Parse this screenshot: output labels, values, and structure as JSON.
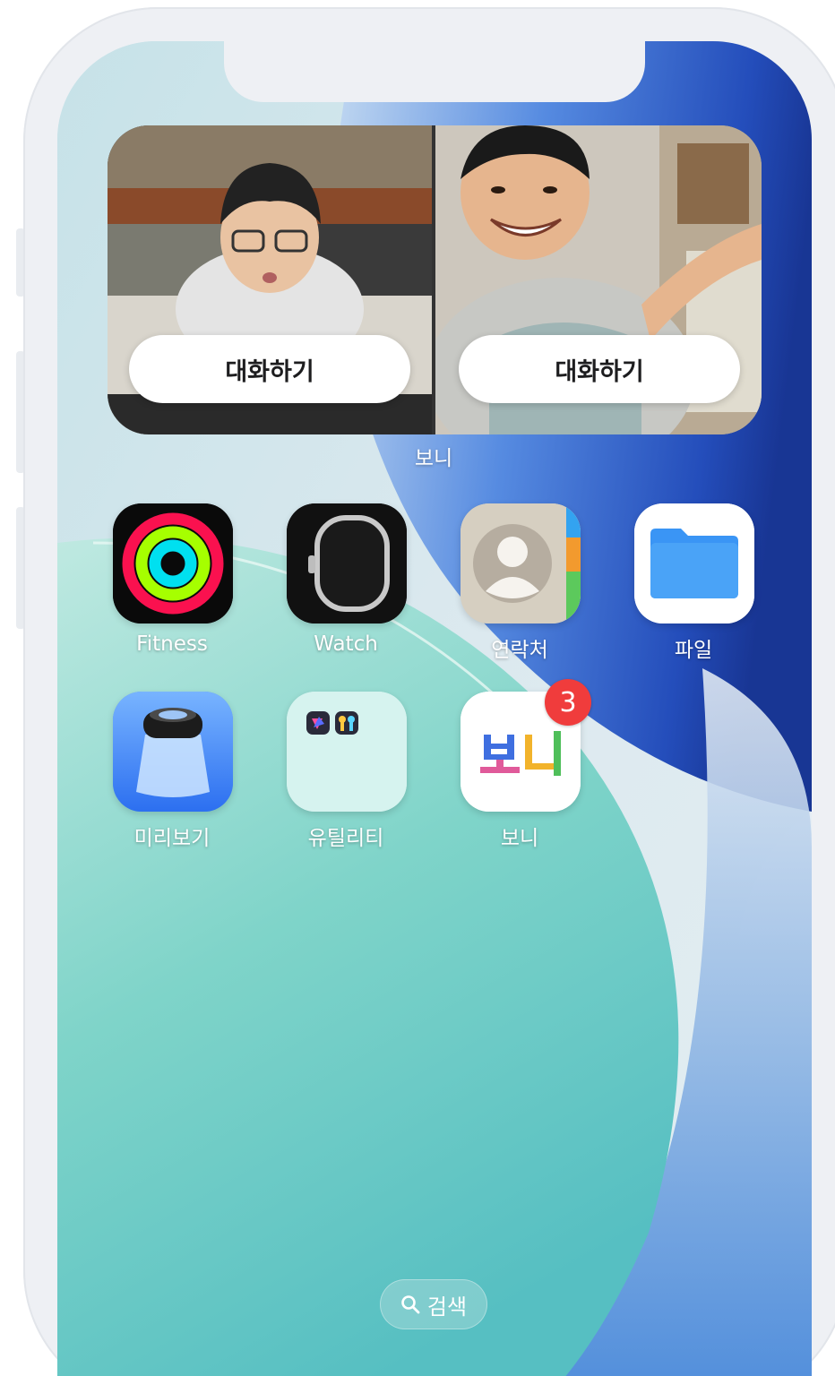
{
  "widget": {
    "left_button_label": "대화하기",
    "right_button_label": "대화하기",
    "label": "보니"
  },
  "apps": {
    "row1": [
      {
        "label": "Fitness",
        "icon": "activity-rings-icon"
      },
      {
        "label": "Watch",
        "icon": "watch-icon"
      },
      {
        "label": "연락처",
        "icon": "contacts-icon"
      },
      {
        "label": "파일",
        "icon": "folder-icon"
      }
    ],
    "row2": [
      {
        "label": "미리보기",
        "icon": "preview-loupe-icon"
      },
      {
        "label": "유틸리티",
        "icon": "utilities-folder-icon"
      },
      {
        "label": "보니",
        "icon": "boni-logo-icon",
        "badge": "3"
      }
    ]
  },
  "boni_logo_text": "보니",
  "search": {
    "label": "검색",
    "icon": "search-icon"
  },
  "colors": {
    "badge": "#f03c3c",
    "fitness_outer": "#fa114f",
    "fitness_mid": "#a6ff00",
    "fitness_inner": "#00e0f0",
    "files_folder": "#3a95f5"
  }
}
